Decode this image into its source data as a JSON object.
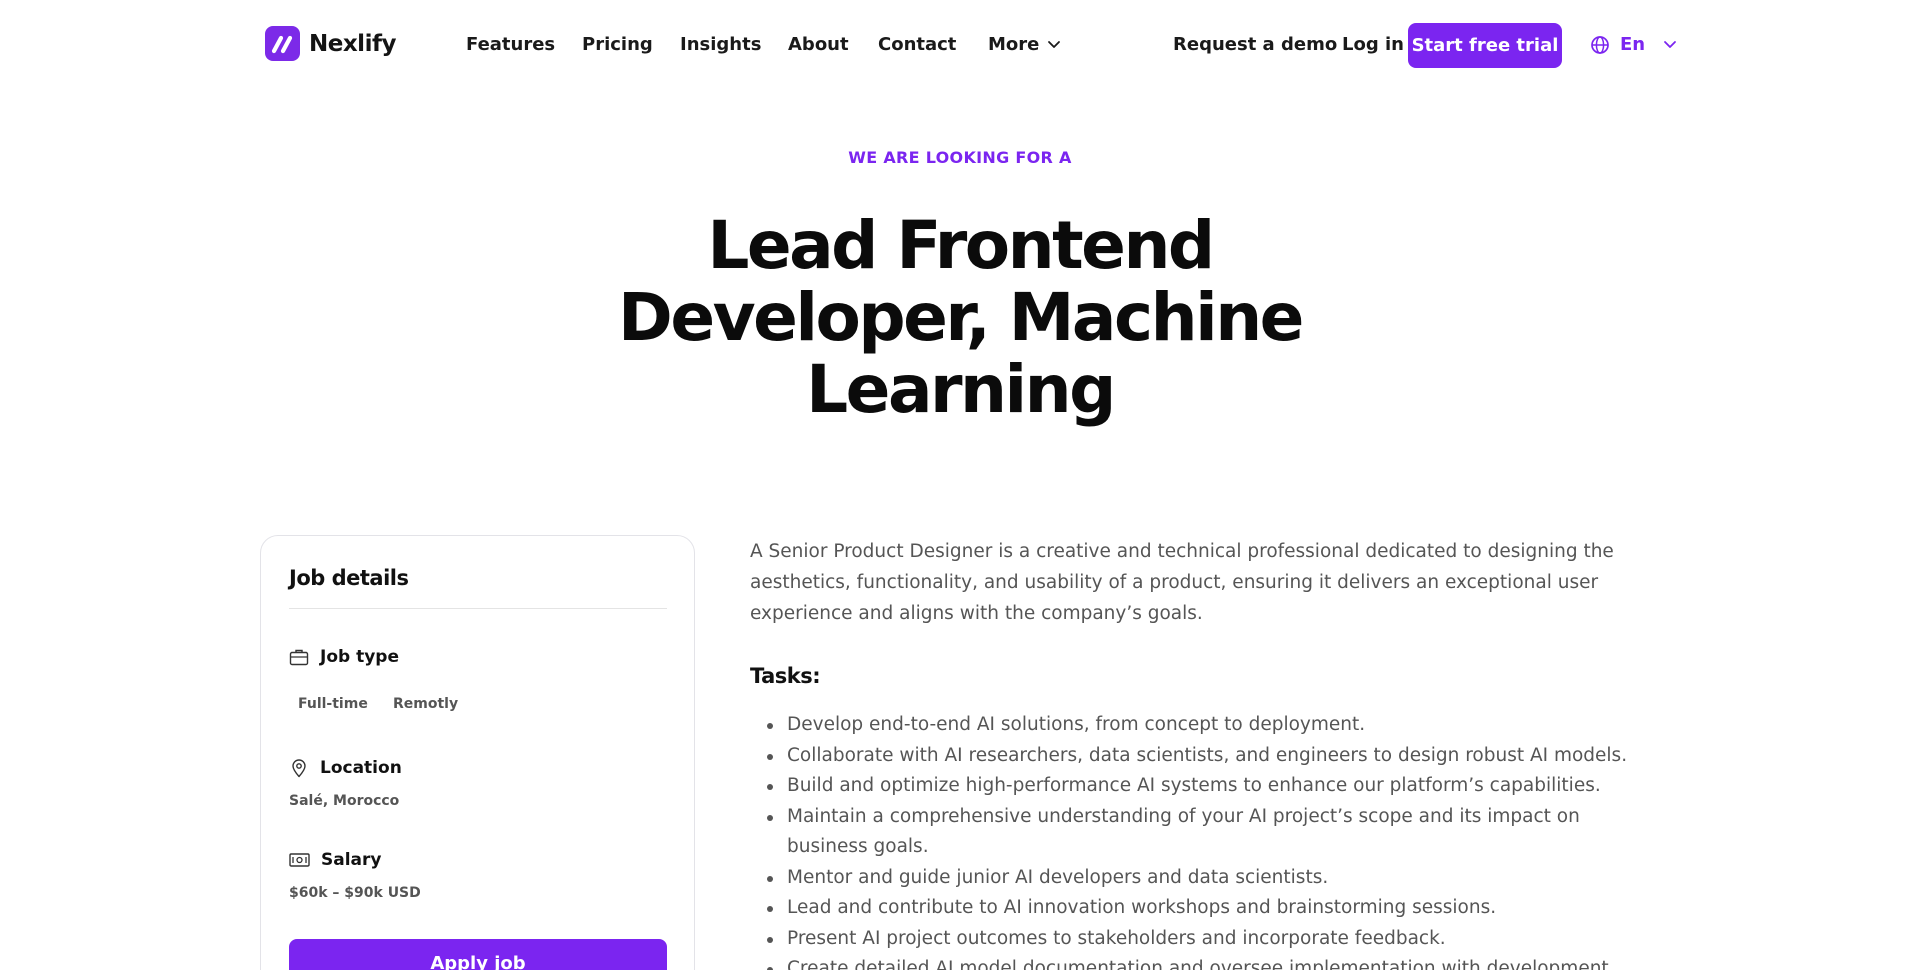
{
  "brand": {
    "name": "Nexlify",
    "accent": "#7b25f0"
  },
  "nav": {
    "links": [
      "Features",
      "Pricing",
      "Insights",
      "About",
      "Contact"
    ],
    "more_label": "More",
    "demo_label": "Request a demo",
    "login_label": "Log in",
    "trial_label": "Start free trial",
    "language": "En"
  },
  "hero": {
    "eyebrow": "WE ARE LOOKING FOR A",
    "title": "Lead Frontend Developer, Machine Learning"
  },
  "job_card": {
    "title": "Job details",
    "job_type_label": "Job type",
    "job_type_tags": [
      "Full-time",
      "Remotly"
    ],
    "location_label": "Location",
    "location_value": "Salé, Morocco",
    "salary_label": "Salary",
    "salary_value": "$60k – $90k USD",
    "apply_label": "Apply job"
  },
  "description": "A Senior Product Designer is a creative and technical professional dedicated to designing the aesthetics, functionality, and usability of a product, ensuring it delivers an exceptional user experience and aligns with the company’s goals.",
  "tasks": {
    "title": "Tasks:",
    "items": [
      "Develop end-to-end AI solutions, from concept to deployment.",
      "Collaborate with AI researchers, data scientists, and engineers to design robust AI models.",
      "Build and optimize high-performance AI systems to enhance our platform’s capabilities.",
      "Maintain a comprehensive understanding of your AI project’s scope and its impact on business goals.",
      "Mentor and guide junior AI developers and data scientists.",
      "Lead and contribute to AI innovation workshops and brainstorming sessions.",
      "Present AI project outcomes to stakeholders and incorporate feedback.",
      "Create detailed AI model documentation and oversee implementation with development"
    ]
  }
}
